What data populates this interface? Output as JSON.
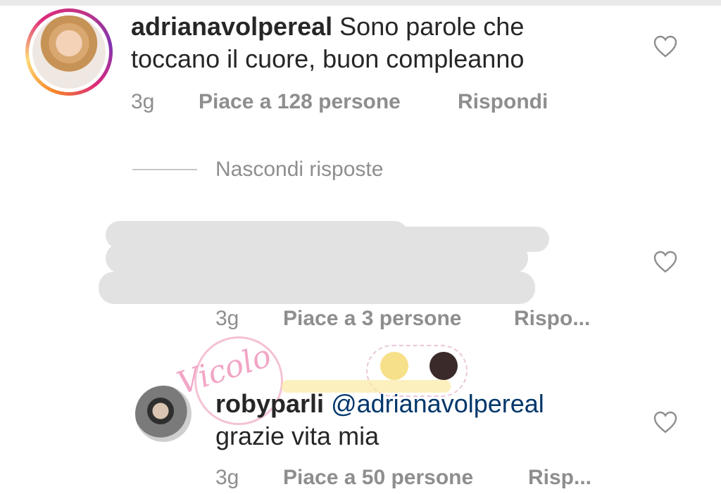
{
  "comment1": {
    "username": "adrianavolpereal",
    "text_line1": "Sono parole che",
    "text_line2": "toccano il cuore, buon compleanno",
    "time": "3g",
    "likes": "Piace a 128 persone",
    "reply": "Rispondi"
  },
  "replies_toggle": {
    "label": "Nascondi risposte"
  },
  "comment2": {
    "time": "3g",
    "likes": "Piace a 3 persone",
    "reply": "Rispo..."
  },
  "comment3": {
    "username": "robyparli",
    "mention": "@adrianavolpereal",
    "text": "grazie vita mia",
    "time": "3g",
    "likes": "Piace a 50 persone",
    "reply": "Risp..."
  },
  "icons": {
    "like": "heart-outline-icon"
  },
  "colors": {
    "mention": "#00376b",
    "meta": "#8e8e8e",
    "text": "#262626"
  }
}
